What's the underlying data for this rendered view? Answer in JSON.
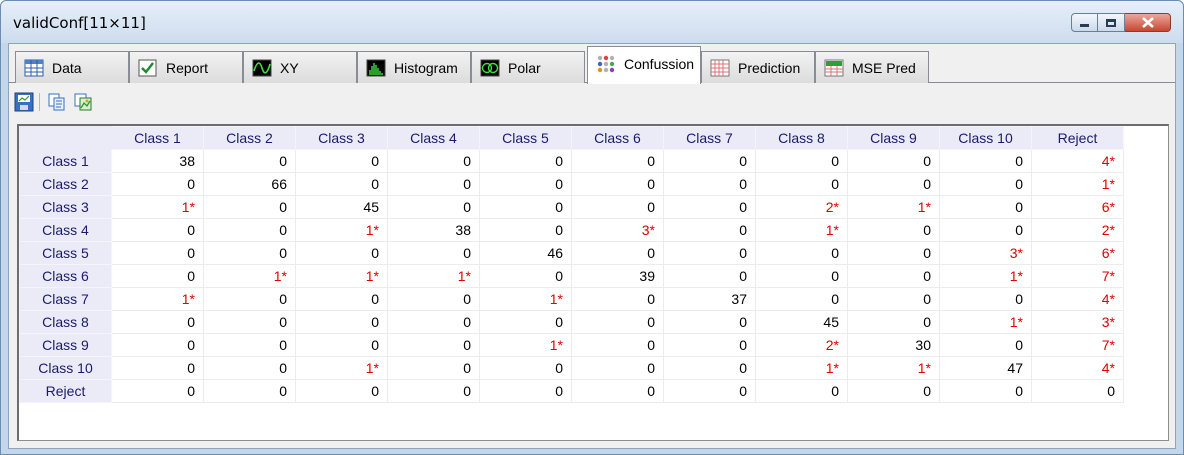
{
  "window": {
    "title": "validConf[11×11]",
    "buttons": {
      "minimize": "minimize",
      "maximize": "maximize",
      "close": "close"
    }
  },
  "tabs": [
    {
      "label": "Data",
      "icon": "table-icon",
      "active": false
    },
    {
      "label": "Report",
      "icon": "checkmark-icon",
      "active": false
    },
    {
      "label": "XY",
      "icon": "wave-plot-icon",
      "active": false
    },
    {
      "label": "Histogram",
      "icon": "histogram-icon",
      "active": false
    },
    {
      "label": "Polar",
      "icon": "polar-plot-icon",
      "active": false
    },
    {
      "label": "Confussion",
      "icon": "dots-matrix-icon",
      "active": true
    },
    {
      "label": "Prediction",
      "icon": "grid-icon",
      "active": false
    },
    {
      "label": "MSE Pred",
      "icon": "mse-icon",
      "active": false
    }
  ],
  "toolbar": {
    "buttons": [
      {
        "name": "save-image-button",
        "icon": "save-image-icon"
      },
      {
        "name": "copy-button",
        "icon": "copy-icon"
      },
      {
        "name": "copy-image-button",
        "icon": "copy-image-icon"
      }
    ]
  },
  "matrix": {
    "columns": [
      "Class 1",
      "Class 2",
      "Class 3",
      "Class 4",
      "Class 5",
      "Class 6",
      "Class 7",
      "Class 8",
      "Class 9",
      "Class 10",
      "Reject"
    ],
    "rows": [
      {
        "label": "Class 1",
        "cells": [
          "38",
          "0",
          "0",
          "0",
          "0",
          "0",
          "0",
          "0",
          "0",
          "0",
          "4*"
        ]
      },
      {
        "label": "Class 2",
        "cells": [
          "0",
          "66",
          "0",
          "0",
          "0",
          "0",
          "0",
          "0",
          "0",
          "0",
          "1*"
        ]
      },
      {
        "label": "Class 3",
        "cells": [
          "1*",
          "0",
          "45",
          "0",
          "0",
          "0",
          "0",
          "2*",
          "1*",
          "0",
          "6*"
        ]
      },
      {
        "label": "Class 4",
        "cells": [
          "0",
          "0",
          "1*",
          "38",
          "0",
          "3*",
          "0",
          "1*",
          "0",
          "0",
          "2*"
        ]
      },
      {
        "label": "Class 5",
        "cells": [
          "0",
          "0",
          "0",
          "0",
          "46",
          "0",
          "0",
          "0",
          "0",
          "3*",
          "6*"
        ]
      },
      {
        "label": "Class 6",
        "cells": [
          "0",
          "1*",
          "1*",
          "1*",
          "0",
          "39",
          "0",
          "0",
          "0",
          "1*",
          "7*"
        ]
      },
      {
        "label": "Class 7",
        "cells": [
          "1*",
          "0",
          "0",
          "0",
          "1*",
          "0",
          "37",
          "0",
          "0",
          "0",
          "4*"
        ]
      },
      {
        "label": "Class 8",
        "cells": [
          "0",
          "0",
          "0",
          "0",
          "0",
          "0",
          "0",
          "45",
          "0",
          "1*",
          "3*"
        ]
      },
      {
        "label": "Class 9",
        "cells": [
          "0",
          "0",
          "0",
          "0",
          "1*",
          "0",
          "0",
          "2*",
          "30",
          "0",
          "7*"
        ]
      },
      {
        "label": "Class 10",
        "cells": [
          "0",
          "0",
          "1*",
          "0",
          "0",
          "0",
          "0",
          "1*",
          "1*",
          "47",
          "4*"
        ]
      },
      {
        "label": "Reject",
        "cells": [
          "0",
          "0",
          "0",
          "0",
          "0",
          "0",
          "0",
          "0",
          "0",
          "0",
          "0"
        ]
      }
    ]
  },
  "colors": {
    "error_cell": "#e00000",
    "header_text": "#1a1a6e",
    "header_bg": "#ebebf7",
    "window_frame": "#c3d6ea"
  }
}
